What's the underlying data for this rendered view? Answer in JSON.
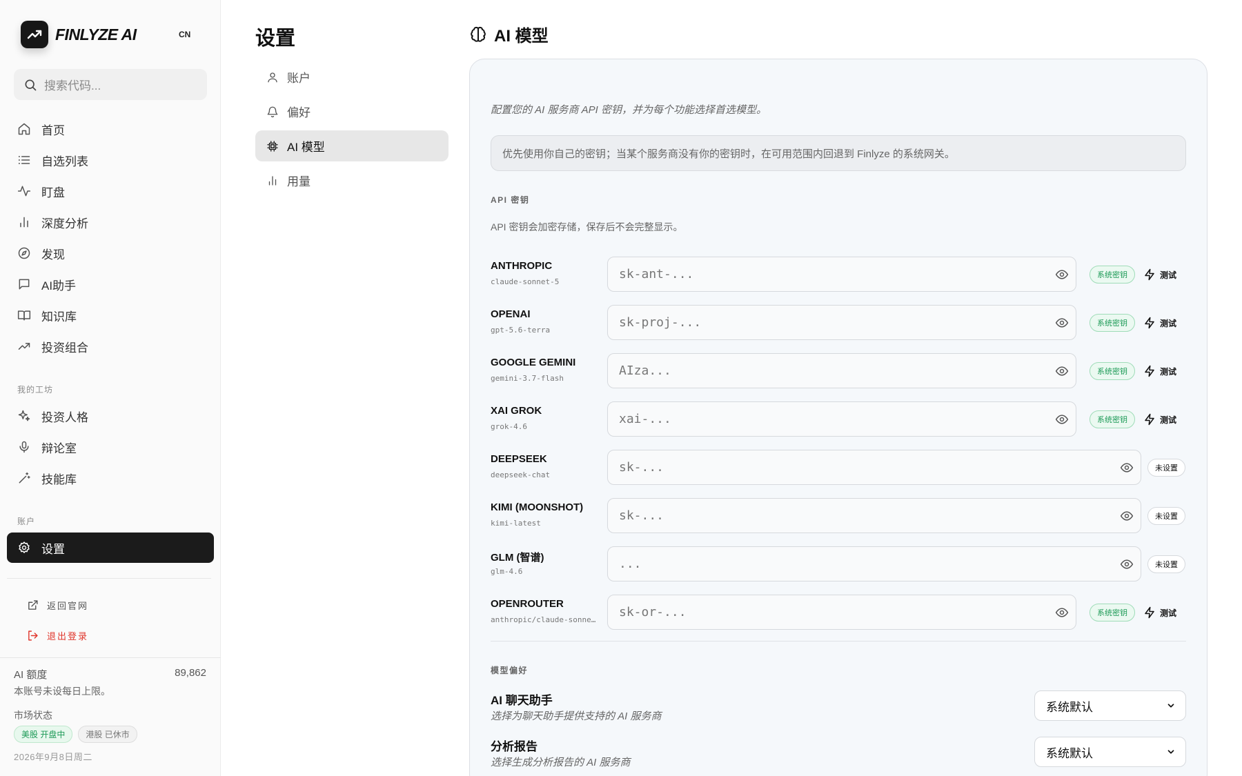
{
  "brand": {
    "name": "FINLYZE AI",
    "lang": "CN"
  },
  "search": {
    "placeholder": "搜索代码..."
  },
  "nav": {
    "items": [
      {
        "label": "首页"
      },
      {
        "label": "自选列表"
      },
      {
        "label": "盯盘"
      },
      {
        "label": "深度分析"
      },
      {
        "label": "发现"
      },
      {
        "label": "AI助手"
      },
      {
        "label": "知识库"
      },
      {
        "label": "投资组合"
      }
    ],
    "workshop_label": "我的工坊",
    "workshop_items": [
      {
        "label": "投资人格"
      },
      {
        "label": "辩论室"
      },
      {
        "label": "技能库"
      }
    ],
    "account_label": "账户",
    "settings_label": "设置"
  },
  "links": {
    "back": "返回官网",
    "logout": "退出登录"
  },
  "quota": {
    "label": "AI 额度",
    "value": "89,862",
    "note": "本账号未设每日上限。"
  },
  "market": {
    "label": "市场状态",
    "us": {
      "name": "美股",
      "status": "开盘中"
    },
    "hk": {
      "name": "港股",
      "status": "已休市"
    },
    "date": "2026年9月8日周二"
  },
  "settings": {
    "title": "设置",
    "nav": [
      {
        "label": "账户"
      },
      {
        "label": "偏好"
      },
      {
        "label": "AI 模型"
      },
      {
        "label": "用量"
      }
    ]
  },
  "main": {
    "title": "AI 模型",
    "description": "配置您的 AI 服务商 API 密钥，并为每个功能选择首选模型。",
    "info": "优先使用你自己的密钥；当某个服务商没有你的密钥时，在可用范围内回退到 Finlyze 的系统网关。",
    "api_section": "API 密钥",
    "api_note": "API 密钥会加密存储，保存后不会完整显示。",
    "system_key_label": "系统密钥",
    "test_label": "测试",
    "unset_label": "未设置",
    "providers": [
      {
        "name": "ANTHROPIC",
        "model": "claude-sonnet-5",
        "placeholder": "sk-ant-...",
        "status": "system"
      },
      {
        "name": "OPENAI",
        "model": "gpt-5.6-terra",
        "placeholder": "sk-proj-...",
        "status": "system"
      },
      {
        "name": "GOOGLE GEMINI",
        "model": "gemini-3.7-flash",
        "placeholder": "AIza...",
        "status": "system"
      },
      {
        "name": "XAI GROK",
        "model": "grok-4.6",
        "placeholder": "xai-...",
        "status": "system"
      },
      {
        "name": "DEEPSEEK",
        "model": "deepseek-chat",
        "placeholder": "sk-...",
        "status": "unset"
      },
      {
        "name": "KIMI (MOONSHOT)",
        "model": "kimi-latest",
        "placeholder": "sk-...",
        "status": "unset"
      },
      {
        "name": "GLM (智谱)",
        "model": "glm-4.6",
        "placeholder": "...",
        "status": "unset"
      },
      {
        "name": "OPENROUTER",
        "model": "anthropic/claude-sonne…",
        "placeholder": "sk-or-...",
        "status": "system"
      }
    ],
    "pref_section": "模型偏好",
    "prefs": [
      {
        "title": "AI 聊天助手",
        "subtitle": "选择为聊天助手提供支持的 AI 服务商",
        "value": "系统默认"
      },
      {
        "title": "分析报告",
        "subtitle": "选择生成分析报告的 AI 服务商",
        "value": "系统默认"
      }
    ]
  },
  "colors": {
    "accent_green": "#1d9a57",
    "danger": "#e0352b",
    "active_dark": "#1b1b1b"
  }
}
